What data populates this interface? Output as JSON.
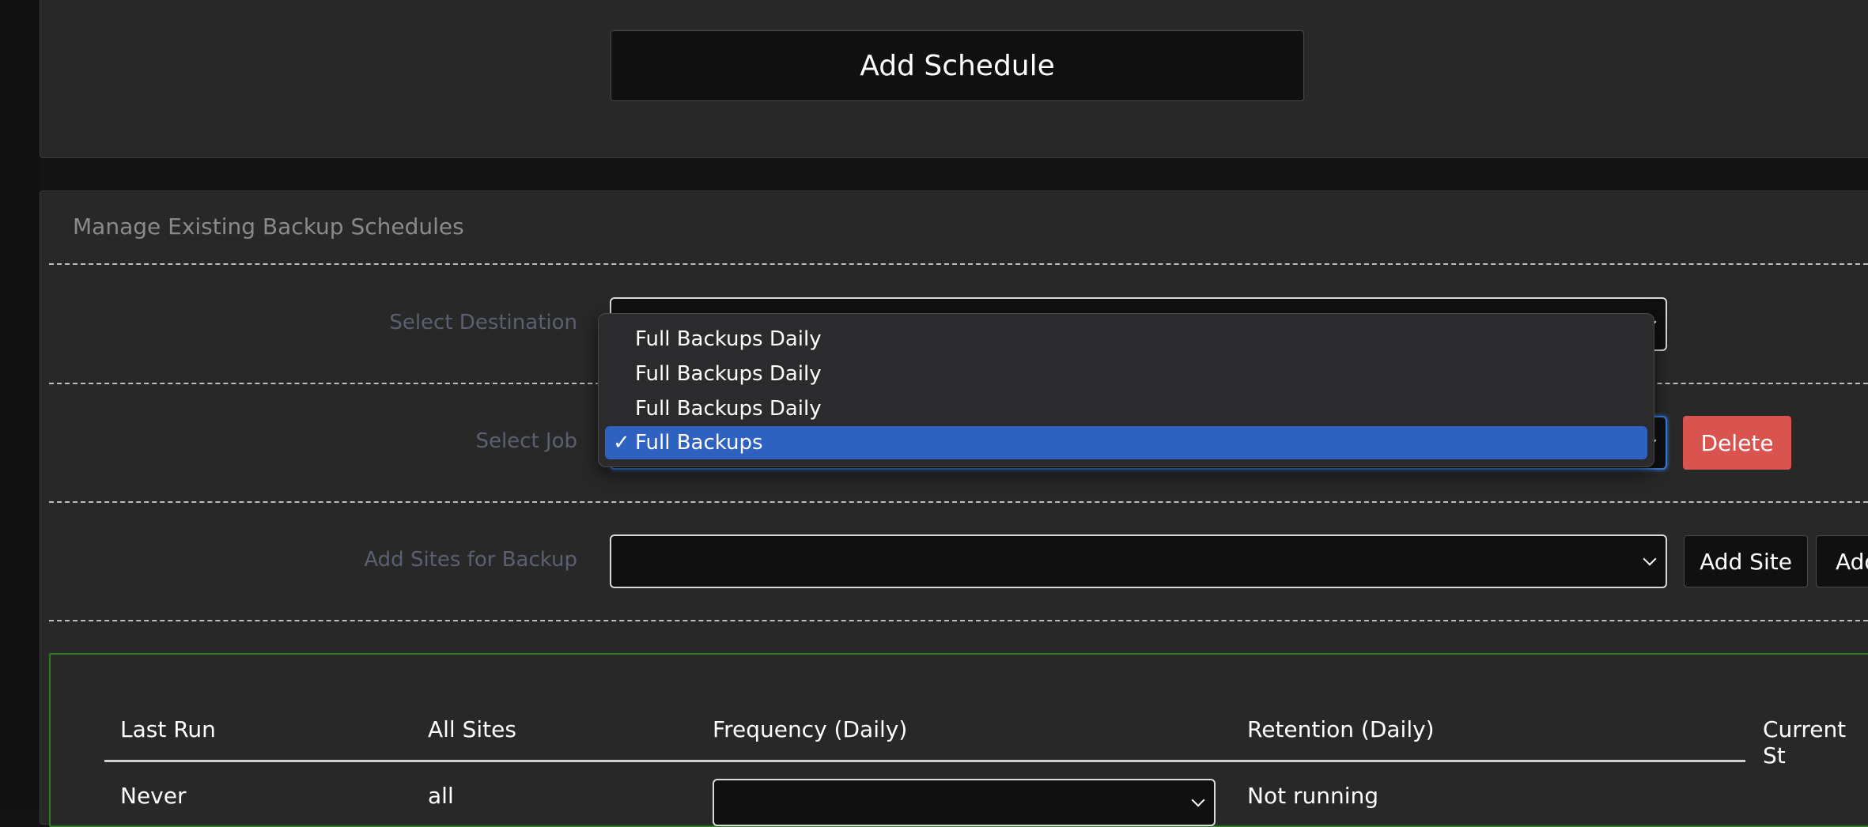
{
  "top_panel": {
    "add_schedule_label": "Add Schedule"
  },
  "manage": {
    "title": "Manage Existing Backup Schedules",
    "destination_label": "Select Destination",
    "job_label": "Select Job",
    "sites_label": "Add Sites for Backup",
    "delete_label": "Delete",
    "add_site_label": "Add Site",
    "add_extra_label": "Add"
  },
  "dropdown": {
    "options": [
      "Full Backups Daily",
      "Full Backups Daily",
      "Full Backups Daily",
      "Full Backups"
    ],
    "selected_index": 3,
    "check_mark": "✓"
  },
  "table": {
    "headers": [
      "Last Run",
      "All Sites",
      "Frequency (Daily)",
      "Retention (Daily)",
      "Current St"
    ],
    "row": {
      "last_run": "Never",
      "all_sites": "all",
      "status": "Not running"
    }
  },
  "colors": {
    "delete": "#d9534f",
    "selected_option": "#2f62c0",
    "focus_ring": "#3b7ddd",
    "sites_border": "#2f7a22"
  }
}
